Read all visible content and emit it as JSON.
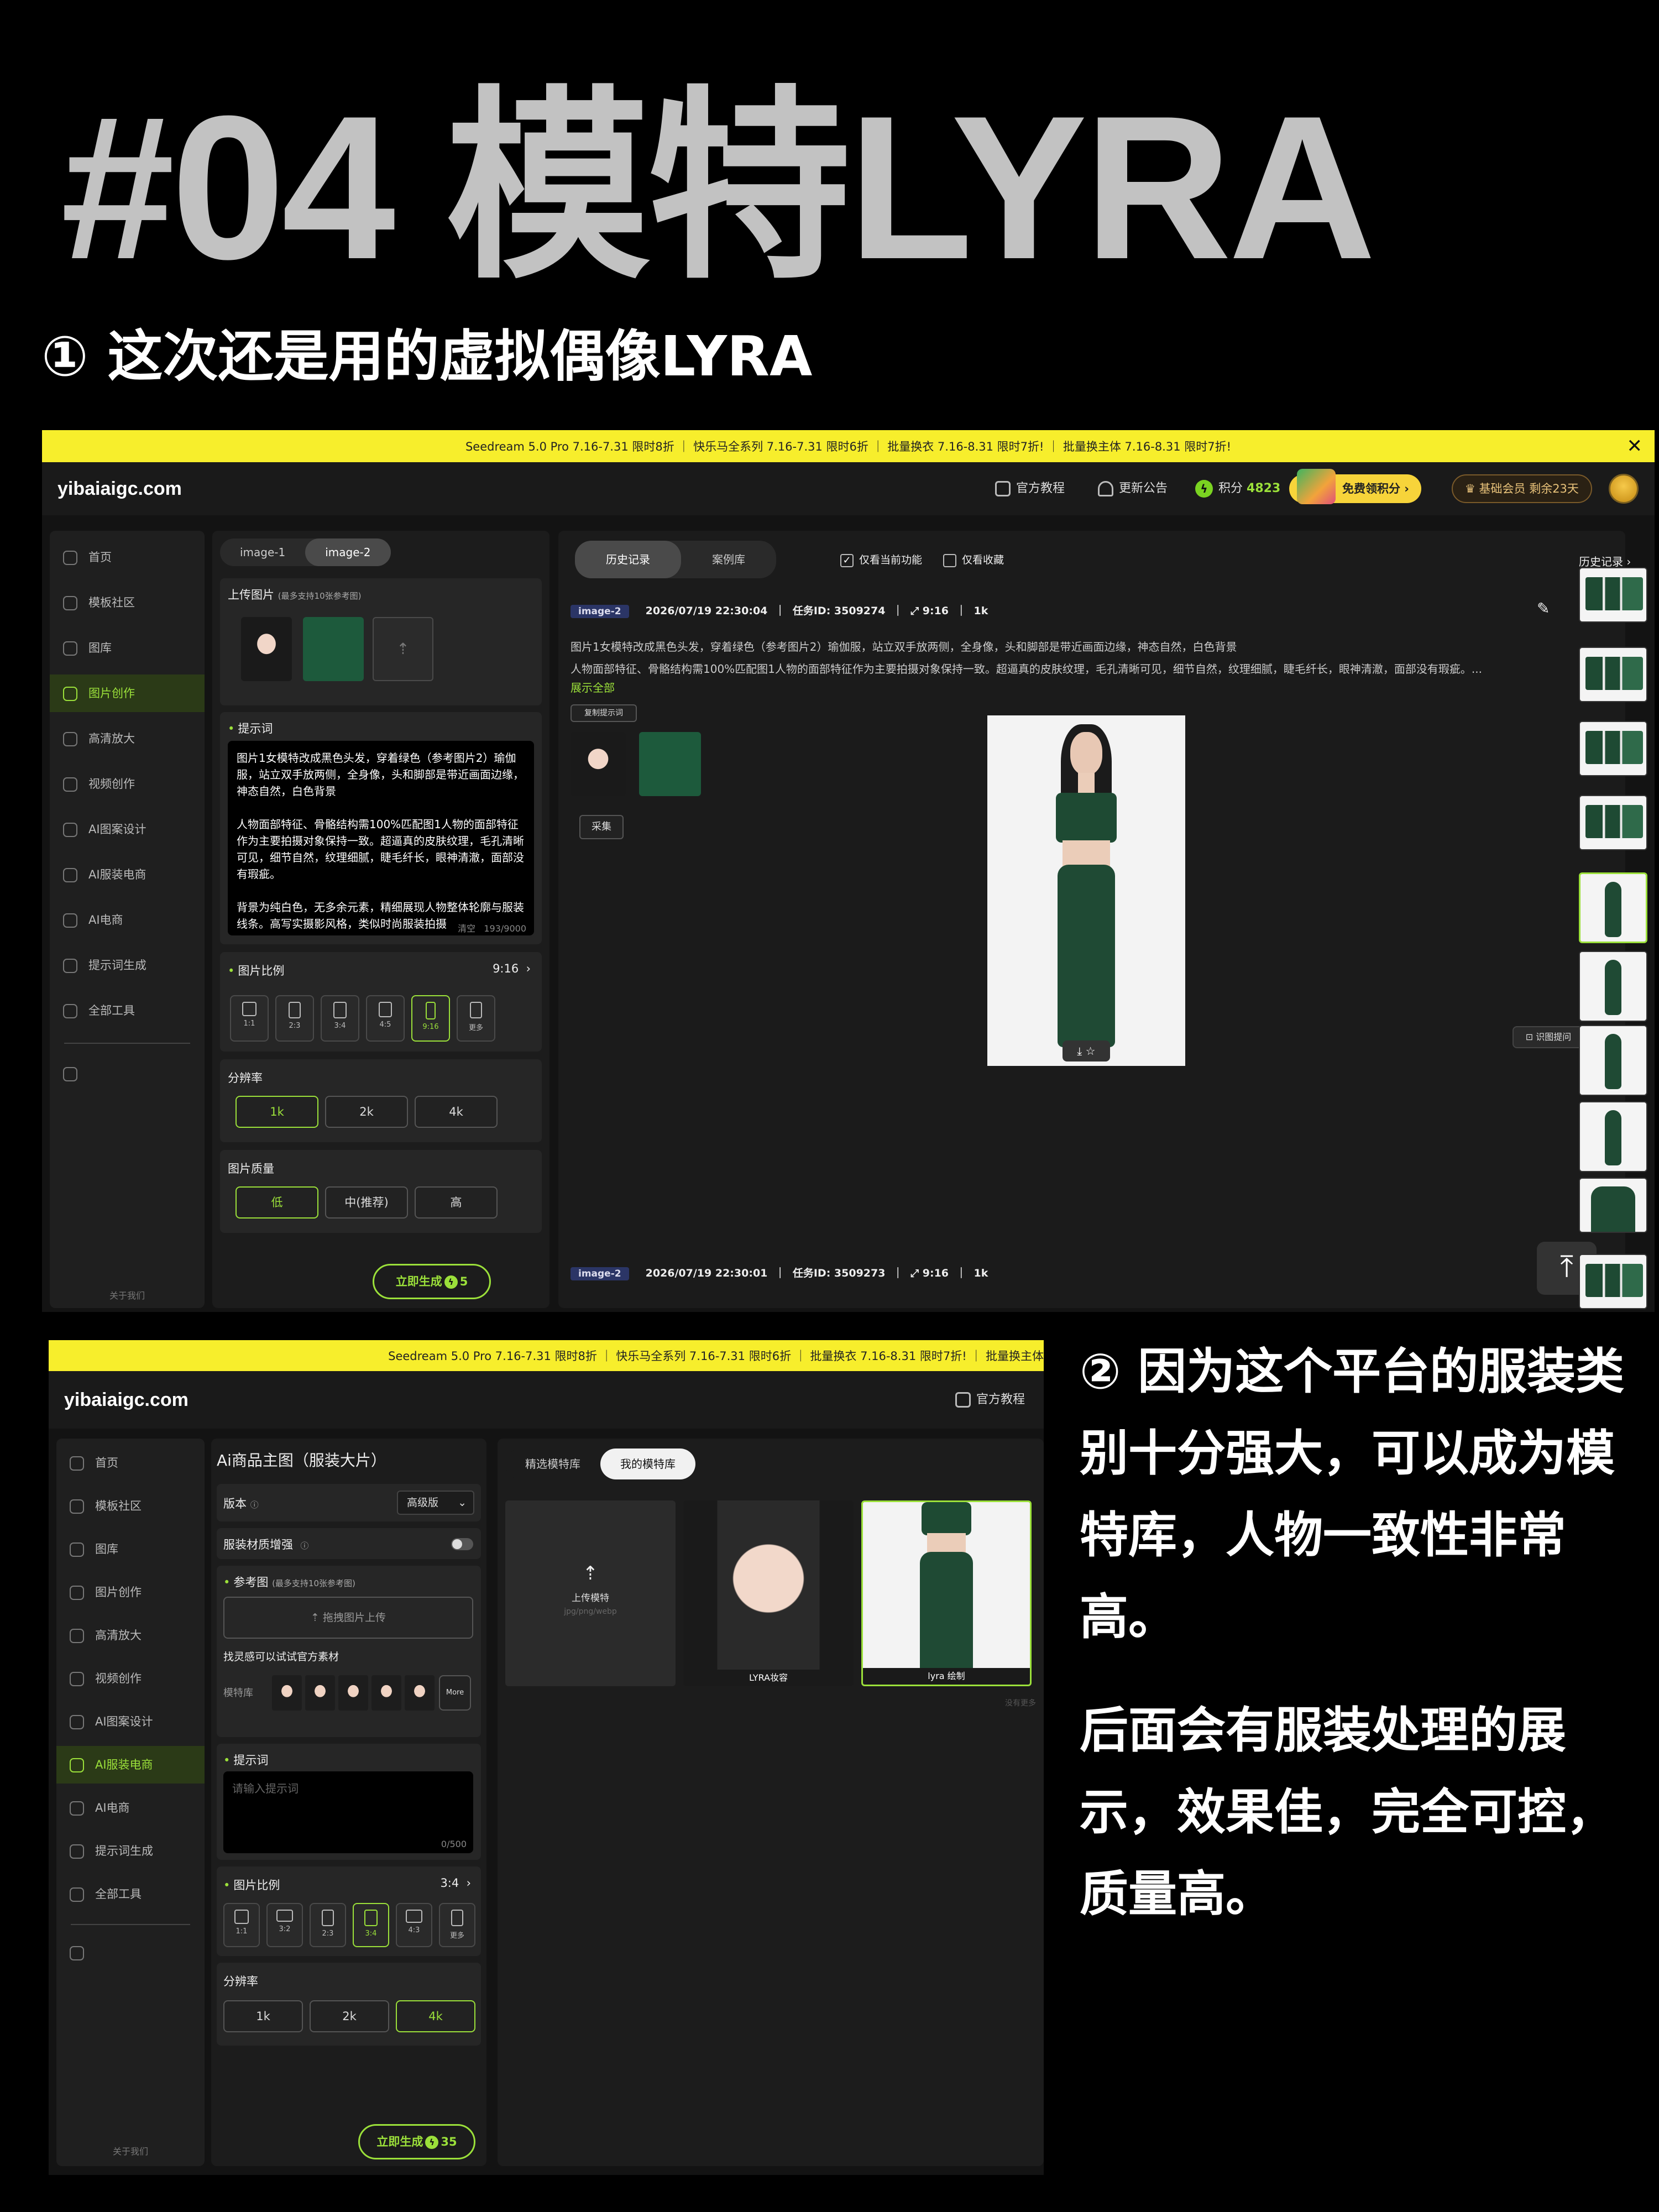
{
  "headline": "#04 模特LYRA",
  "subtitle1": "① 这次还是用的虚拟偶像LYRA",
  "subtitle2": "② 因为这个平台的服装类别十分强大，可以成为模特库，人物一致性非常高。",
  "subtitle3": "后面会有服装处理的展示，效果佳，完全可控，质量高。",
  "shot1": {
    "promo": "Seedream 5.0 Pro 7.16-7.31 限时8折 ｜ 快乐马全系列 7.16-7.31 限时6折 ｜ 批量换衣 7.16-8.31 限时7折! ｜ 批量换主体 7.16-8.31 限时7折!",
    "close": "✕",
    "logo": "yibaiaigc.com",
    "top": {
      "tutorial": "官方教程",
      "notice": "更新公告",
      "points_label": "积分",
      "points_value": "4823",
      "free_points": "免费领积分 ›",
      "vip": "基础会员 剩余23天"
    },
    "sidebar": [
      "首页",
      "模板社区",
      "图库",
      "图片创作",
      "高清放大",
      "视频创作",
      "AI图案设计",
      "AI服装电商",
      "AI电商",
      "提示词生成",
      "全部工具"
    ],
    "sidebar_active": 3,
    "sidebar_footer": "关于我们",
    "panel": {
      "tabs": [
        "image-1",
        "image-2"
      ],
      "upload_label": "上传图片",
      "upload_hint": "(最多支持10张参考图)",
      "prompt_label": "提示词",
      "prompt_p1": "图片1女模特改成黑色头发，穿着绿色（参考图片2）瑜伽服，站立双手放两侧，全身像，头和脚部是带近画面边缘，神态自然，白色背景",
      "prompt_p2": "人物面部特征、骨骼结构需100%匹配图1人物的面部特征作为主要拍摄对象保持一致。超逼真的皮肤纹理，毛孔清晰可见，细节自然，纹理细腻，睫毛纤长，眼神清澈，面部没有瑕疵。",
      "prompt_p3": "背景为纯白色，无多余元素，精细展现人物整体轮廓与服装线条。高写实摄影风格，类似时尚服装拍摄",
      "clear": "清空",
      "count": "193/9000",
      "ratio_label": "图片比例",
      "ratio_value": "9:16",
      "ratios": [
        "1:1",
        "2:3",
        "3:4",
        "4:5",
        "9:16",
        "更多"
      ],
      "ratio_active": 4,
      "res_label": "分辨率",
      "res": [
        "1k",
        "2k",
        "4k"
      ],
      "res_active": 0,
      "quality_label": "图片质量",
      "quality": [
        "低",
        "中(推荐)",
        "高"
      ],
      "quality_active": 0,
      "generate": "立即生成",
      "cost": "5"
    },
    "main": {
      "tabs": [
        "历史记录",
        "案例库"
      ],
      "check1": "仅看当前功能",
      "check2": "仅看收藏",
      "tag": "image-2",
      "time": "2026/07/19 22:30:04",
      "task": "任务ID: 3509274",
      "ratio": "9:16",
      "res": "1k",
      "desc1": "图片1女模特改成黑色头发，穿着绿色（参考图片2）瑜伽服，站立双手放两侧，全身像，头和脚部是带近画面边缘，神态自然，白色背景",
      "desc2": "人物面部特征、骨骼结构需100%匹配图1人物的面部特征作为主要拍摄对象保持一致。超逼真的皮肤纹理，毛孔清晰可见，细节自然，纹理细腻，睫毛纤长，眼神清澈，面部没有瑕疵。...",
      "expand": "展示全部",
      "copy_prompt": "复制提示词",
      "collect": "采集",
      "img_tools": "⤓ ☆",
      "reverse": "识图提问",
      "time2": "2026/07/19 22:30:01",
      "task2": "任务ID: 3509273",
      "ratio2": "9:16",
      "res2": "1k",
      "history": "历史记录 ›",
      "back_top": "⤒"
    }
  },
  "shot2": {
    "promo": "Seedream 5.0 Pro 7.16-7.31 限时8折 ｜ 快乐马全系列 7.16-7.31 限时6折 ｜ 批量换衣 7.16-8.31 限时7折! ｜ 批量换主体",
    "logo": "yibaiaigc.com",
    "tutorial": "官方教程",
    "sidebar": [
      "首页",
      "模板社区",
      "图库",
      "图片创作",
      "高清放大",
      "视频创作",
      "AI图案设计",
      "AI服装电商",
      "AI电商",
      "提示词生成",
      "全部工具"
    ],
    "sidebar_active": 7,
    "sidebar_footer": "关于我们",
    "panel": {
      "title": "Ai商品主图（服装大片）",
      "version_label": "版本",
      "version_value": "高级版",
      "material": "服装材质增强",
      "ref_label": "参考图",
      "ref_hint": "(最多支持10张参考图)",
      "upload_btn": "拖拽图片上传",
      "find_label": "找灵感可以试试官方素材",
      "model_lib": "模特库",
      "more": "More",
      "prompt_label": "提示词",
      "prompt_placeholder": "请输入提示词",
      "count": "0/500",
      "ratio_label": "图片比例",
      "ratio_value": "3:4",
      "ratios": [
        "1:1",
        "3:2",
        "2:3",
        "3:4",
        "4:3",
        "更多"
      ],
      "ratio_active": 3,
      "res_label": "分辨率",
      "res": [
        "1k",
        "2k",
        "4k"
      ],
      "res_active": 2,
      "generate": "立即生成",
      "cost": "35"
    },
    "library": {
      "tabs": [
        "精选模特库",
        "我的模特库"
      ],
      "upload": "上传模特",
      "formats": "jpg/png/webp",
      "cards": [
        "LYRA妆容",
        "lyra 绘制"
      ],
      "no_more": "没有更多"
    }
  }
}
